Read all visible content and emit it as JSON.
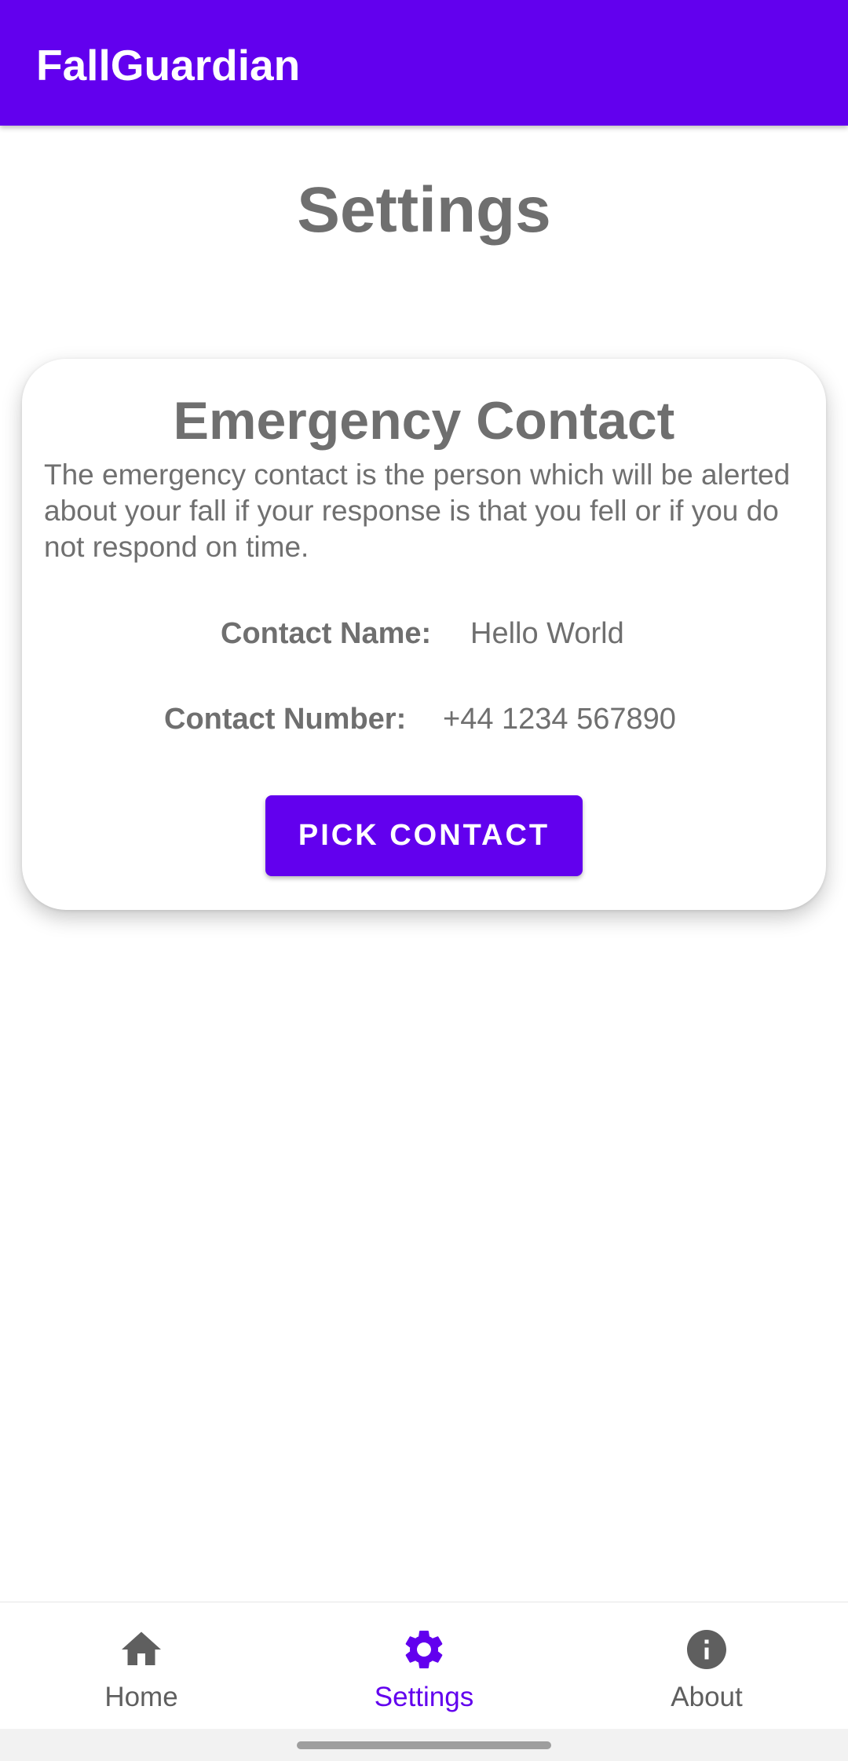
{
  "app_bar": {
    "title": "FallGuardian",
    "color": "#6200ee"
  },
  "page": {
    "title": "Settings"
  },
  "emergency_card": {
    "title": "Emergency Contact",
    "description": "The emergency contact is the person which will be alerted about your fall if your response is that you fell or if you do not respond on time.",
    "contact_name_label": "Contact Name:",
    "contact_name_value": "Hello World",
    "contact_number_label": "Contact Number:",
    "contact_number_value": "+44 1234 567890",
    "pick_contact_label": "PICK CONTACT"
  },
  "bottom_nav": {
    "items": [
      {
        "label": "Home",
        "icon": "home-icon",
        "active": false
      },
      {
        "label": "Settings",
        "icon": "gear-icon",
        "active": true
      },
      {
        "label": "About",
        "icon": "info-icon",
        "active": false
      }
    ],
    "active_color": "#6200ee",
    "inactive_color": "#5f5f5f"
  }
}
